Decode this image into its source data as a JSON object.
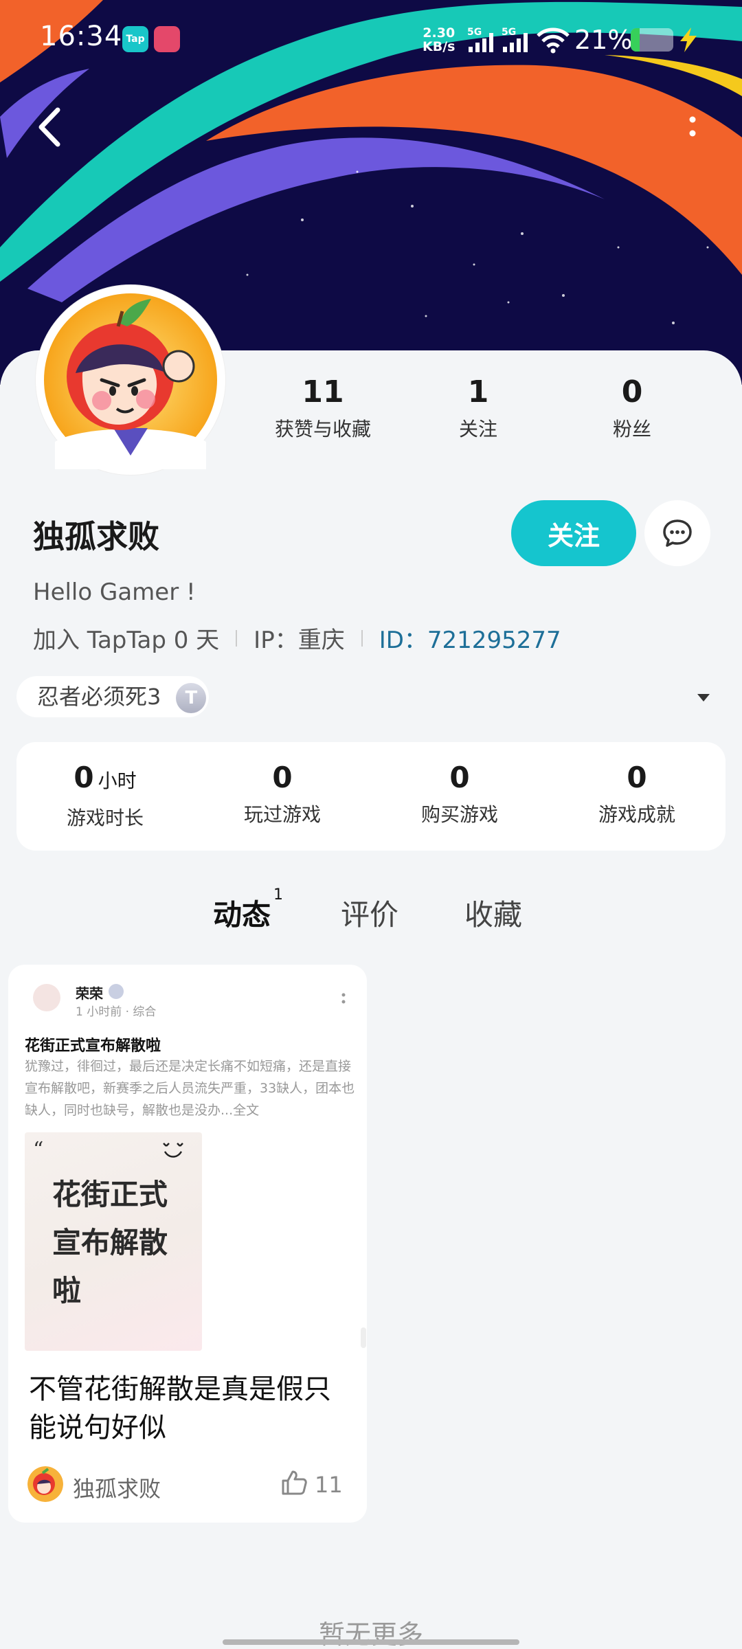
{
  "status_bar": {
    "time": "16:34",
    "tap_icon_text": "Tap",
    "speed_value": "2.30",
    "speed_unit": "KB/s",
    "sig1_label": "5G",
    "sig2_label": "5G",
    "battery_percent": "21%",
    "battery_level": 0.21
  },
  "profile": {
    "stats": [
      {
        "num": "11",
        "label": "获赞与收藏"
      },
      {
        "num": "1",
        "label": "关注"
      },
      {
        "num": "0",
        "label": "粉丝"
      }
    ],
    "username": "独孤求败",
    "follow_label": "关注",
    "bio": "Hello Gamer !",
    "joined": "加入 TapTap 0 天",
    "ip": "IP：重庆",
    "user_id": "ID：721295277"
  },
  "game_tag": {
    "name": "忍者必须死3",
    "badge": "T"
  },
  "game_stats": [
    {
      "num": "0",
      "unit": "小时",
      "label": "游戏时长"
    },
    {
      "num": "0",
      "unit": "",
      "label": "玩过游戏"
    },
    {
      "num": "0",
      "unit": "",
      "label": "购买游戏"
    },
    {
      "num": "0",
      "unit": "",
      "label": "游戏成就"
    }
  ],
  "tabs": [
    {
      "label": "动态",
      "count": "1"
    },
    {
      "label": "评价",
      "count": ""
    },
    {
      "label": "收藏",
      "count": ""
    }
  ],
  "post": {
    "embedded": {
      "author": "荣荣",
      "time": "1 小时前 · 综合",
      "title": "花街正式宣布解散啦",
      "body": "犹豫过，徘徊过，最后还是决定长痛不如短痛，还是直接宣布解散吧，新赛季之后人员流失严重，33缺人，团本也缺人，同时也缺号，解散也是没办",
      "full_label": "...全文",
      "cover_text": "花街正式宣布解散啦"
    },
    "caption": "不管花街解散是真是假只能说句好似",
    "author": "独孤求败",
    "likes": "11"
  },
  "footer": {
    "no_more": "暂无更多"
  },
  "colors": {
    "accent": "#15c5ce",
    "id_link": "#1d6f98",
    "banner_bg": "#0e0a45"
  },
  "icons": [
    "back-arrow-icon",
    "more-vertical-icon",
    "chat-bubble-icon",
    "dropdown-arrow-icon",
    "thumbs-up-icon",
    "wifi-icon",
    "signal-icon",
    "battery-icon",
    "charging-bolt-icon"
  ]
}
